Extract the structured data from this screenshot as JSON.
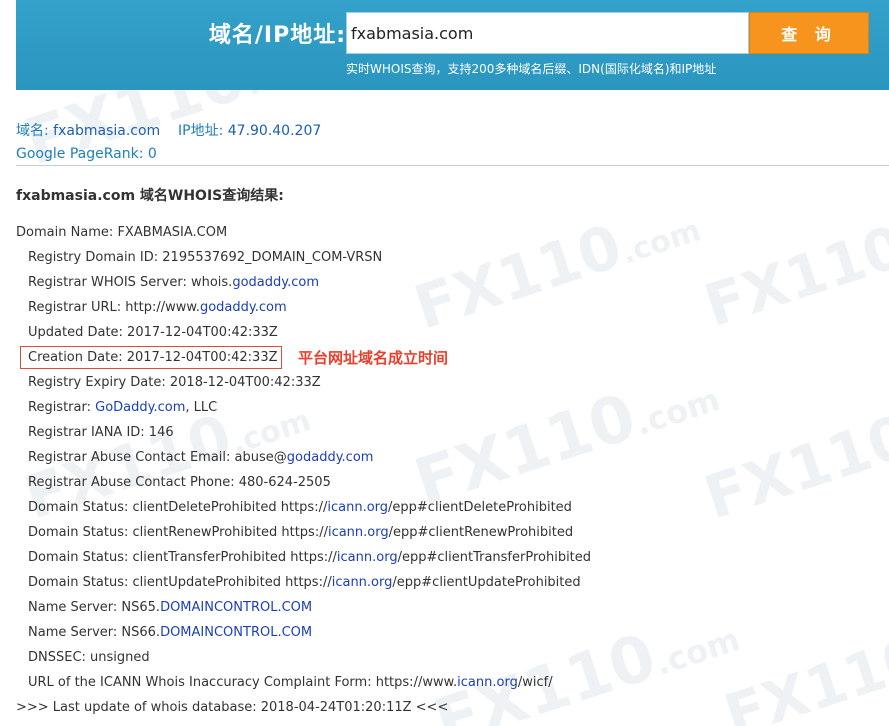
{
  "header": {
    "label": "域名/IP地址:",
    "search_value": "fxabmasia.com",
    "search_button": "查 询",
    "subtitle": "实时WHOIS查询，支持200多种域名后缀、IDN(国际化域名)和IP地址"
  },
  "summary": {
    "domain_label": "域名:",
    "domain_value": "fxabmasia.com",
    "ip_label": "IP地址:",
    "ip_value": "47.90.40.207",
    "pagerank_label": "Google PageRank:",
    "pagerank_value": "0"
  },
  "result_heading": "fxabmasia.com 域名WHOIS查询结果:",
  "annotation": "平台网址域名成立时间",
  "watermark": [
    "FX110",
    ".com"
  ],
  "whois": [
    {
      "parts": [
        {
          "t": "Domain Name: FXABMASIA.COM"
        }
      ]
    },
    {
      "parts": [
        {
          "t": "Registry Domain ID: 2195537692_DOMAIN_COM-VRSN"
        }
      ]
    },
    {
      "parts": [
        {
          "t": "Registrar WHOIS Server: whois."
        },
        {
          "t": "godaddy.com",
          "link": true
        }
      ]
    },
    {
      "parts": [
        {
          "t": "Registrar URL: http://www."
        },
        {
          "t": "godaddy.com",
          "link": true
        }
      ]
    },
    {
      "parts": [
        {
          "t": "Updated Date: 2017-12-04T00:42:33Z"
        }
      ]
    },
    {
      "parts": [
        {
          "t": "Creation Date: 2017-12-04T00:42:33Z"
        }
      ]
    },
    {
      "parts": [
        {
          "t": "Registry Expiry Date: 2018-12-04T00:42:33Z"
        }
      ]
    },
    {
      "parts": [
        {
          "t": "Registrar: "
        },
        {
          "t": "GoDaddy.com",
          "link": true
        },
        {
          "t": ", LLC"
        }
      ]
    },
    {
      "parts": [
        {
          "t": "Registrar IANA ID: 146"
        }
      ]
    },
    {
      "parts": [
        {
          "t": "Registrar Abuse Contact Email: abuse@"
        },
        {
          "t": "godaddy.com",
          "link": true
        }
      ]
    },
    {
      "parts": [
        {
          "t": "Registrar Abuse Contact Phone: 480-624-2505"
        }
      ]
    },
    {
      "parts": [
        {
          "t": "Domain Status: clientDeleteProhibited https://"
        },
        {
          "t": "icann.org",
          "link": true
        },
        {
          "t": "/epp#clientDeleteProhibited"
        }
      ]
    },
    {
      "parts": [
        {
          "t": "Domain Status: clientRenewProhibited https://"
        },
        {
          "t": "icann.org",
          "link": true
        },
        {
          "t": "/epp#clientRenewProhibited"
        }
      ]
    },
    {
      "parts": [
        {
          "t": "Domain Status: clientTransferProhibited https://"
        },
        {
          "t": "icann.org",
          "link": true
        },
        {
          "t": "/epp#clientTransferProhibited"
        }
      ]
    },
    {
      "parts": [
        {
          "t": "Domain Status: clientUpdateProhibited https://"
        },
        {
          "t": "icann.org",
          "link": true
        },
        {
          "t": "/epp#clientUpdateProhibited"
        }
      ]
    },
    {
      "parts": [
        {
          "t": "Name Server: NS65."
        },
        {
          "t": "DOMAINCONTROL.COM",
          "link": true
        }
      ]
    },
    {
      "parts": [
        {
          "t": "Name Server: NS66."
        },
        {
          "t": "DOMAINCONTROL.COM",
          "link": true
        }
      ]
    },
    {
      "parts": [
        {
          "t": "DNSSEC: unsigned"
        }
      ]
    },
    {
      "parts": [
        {
          "t": "URL of the ICANN Whois Inaccuracy Complaint Form: https://www."
        },
        {
          "t": "icann.org",
          "link": true
        },
        {
          "t": "/wicf/"
        }
      ]
    },
    {
      "parts": [
        {
          "t": ">>> Last update of whois database: 2018-04-24T01:20:11Z <<<"
        }
      ]
    }
  ]
}
